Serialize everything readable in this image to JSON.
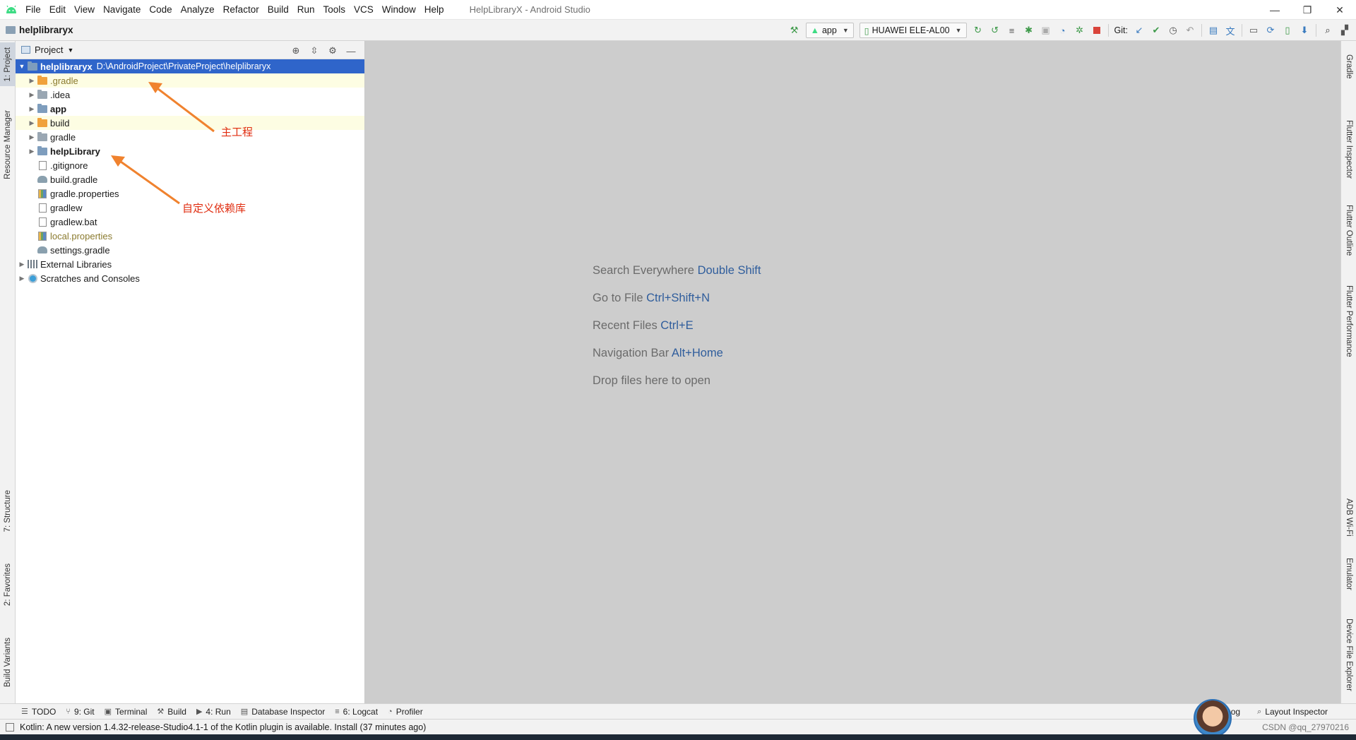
{
  "window": {
    "title": "HelpLibraryX - Android Studio",
    "menu": [
      "File",
      "Edit",
      "View",
      "Navigate",
      "Code",
      "Analyze",
      "Refactor",
      "Build",
      "Run",
      "Tools",
      "VCS",
      "Window",
      "Help"
    ],
    "controls": {
      "minimize": "—",
      "restore": "❐",
      "close": "✕"
    }
  },
  "navbar": {
    "breadcrumb": "helplibraryx",
    "run_config": "app",
    "device": "HUAWEI ELE-AL00",
    "git_label": "Git:"
  },
  "left_tabs": [
    "1: Project",
    "Resource Manager",
    "7: Structure",
    "2: Favorites",
    "Build Variants"
  ],
  "right_tabs": [
    "Gradle",
    "Flutter Inspector",
    "Flutter Outline",
    "Flutter Performance",
    "ADB Wi-Fi",
    "Emulator",
    "Device File Explorer"
  ],
  "project_panel": {
    "title": "Project",
    "root": {
      "name": "helplibraryx",
      "path": "D:\\AndroidProject\\PrivateProject\\helplibraryx"
    },
    "items": [
      {
        "name": ".gradle",
        "kind": "folder-orange",
        "expandable": true
      },
      {
        "name": ".idea",
        "kind": "folder-gray",
        "expandable": true
      },
      {
        "name": "app",
        "kind": "module",
        "expandable": true
      },
      {
        "name": "build",
        "kind": "folder-orange",
        "expandable": true
      },
      {
        "name": "gradle",
        "kind": "folder-gray",
        "expandable": true
      },
      {
        "name": "helpLibrary",
        "kind": "module",
        "expandable": true
      },
      {
        "name": ".gitignore",
        "kind": "file",
        "expandable": false
      },
      {
        "name": "build.gradle",
        "kind": "gradle",
        "expandable": false
      },
      {
        "name": "gradle.properties",
        "kind": "props",
        "expandable": false
      },
      {
        "name": "gradlew",
        "kind": "file",
        "expandable": false
      },
      {
        "name": "gradlew.bat",
        "kind": "file",
        "expandable": false
      },
      {
        "name": "local.properties",
        "kind": "props",
        "expandable": false
      },
      {
        "name": "settings.gradle",
        "kind": "gradle",
        "expandable": false
      }
    ],
    "external_libraries": "External Libraries",
    "scratches": "Scratches and Consoles"
  },
  "annotations": {
    "main_project": "主工程",
    "custom_library": "自定义依赖库"
  },
  "editor_hints": [
    {
      "text": "Search Everywhere",
      "key": "Double Shift"
    },
    {
      "text": "Go to File",
      "key": "Ctrl+Shift+N"
    },
    {
      "text": "Recent Files",
      "key": "Ctrl+E"
    },
    {
      "text": "Navigation Bar",
      "key": "Alt+Home"
    },
    {
      "text": "Drop files here to open",
      "key": ""
    }
  ],
  "bottom_tabs": [
    {
      "label": "TODO",
      "icon": "list-icon"
    },
    {
      "label": "9: Git",
      "icon": "branch-icon"
    },
    {
      "label": "Terminal",
      "icon": "terminal-icon"
    },
    {
      "label": "Build",
      "icon": "hammer-icon"
    },
    {
      "label": "4: Run",
      "icon": "run-icon"
    },
    {
      "label": "Database Inspector",
      "icon": "database-icon"
    },
    {
      "label": "6: Logcat",
      "icon": "logcat-icon"
    },
    {
      "label": "Profiler",
      "icon": "profiler-icon"
    }
  ],
  "bottom_right": {
    "event_log": "og",
    "layout_inspector": "Layout Inspector"
  },
  "status": {
    "message": "Kotlin: A new version 1.4.32-release-Studio4.1-1 of the Kotlin plugin is available. Install (37 minutes ago)",
    "watermark": "CSDN @qq_27970216"
  }
}
